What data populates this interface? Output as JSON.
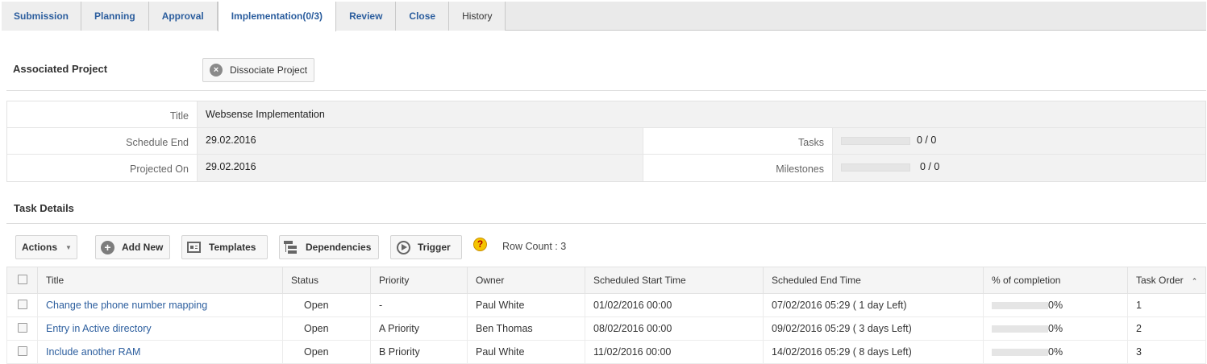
{
  "tabs": [
    "Submission",
    "Planning",
    "Approval",
    "Implementation(0/3)",
    "Review",
    "Close",
    "History"
  ],
  "associated_project": {
    "heading": "Associated Project",
    "dissociate_label": "Dissociate Project",
    "title_label": "Title",
    "title_value": "Websense Implementation",
    "schedule_end_label": "Schedule End",
    "schedule_end_value": "29.02.2016",
    "projected_on_label": "Projected On",
    "projected_on_value": "29.02.2016",
    "tasks_label": "Tasks",
    "tasks_value": "0 / 0",
    "tasks_progress": 0,
    "milestones_label": "Milestones",
    "milestones_value": "0 / 0",
    "milestones_progress": 0
  },
  "task_details": {
    "heading": "Task Details",
    "toolbar": {
      "actions": "Actions",
      "add_new": "Add New",
      "templates": "Templates",
      "dependencies": "Dependencies",
      "trigger": "Trigger",
      "help": "?",
      "row_count": "Row Count : 3"
    },
    "columns": [
      "Title",
      "Status",
      "Priority",
      "Owner",
      "Scheduled Start Time",
      "Scheduled End Time",
      "% of completion",
      "Task Order"
    ],
    "rows": [
      {
        "title": "Change the phone number mapping",
        "status": "Open",
        "priority": "-",
        "owner": "Paul White",
        "start": "01/02/2016 00:00",
        "end": "07/02/2016 05:29 ( 1 day Left)",
        "completion": "0%",
        "order": "1"
      },
      {
        "title": "Entry in Active directory",
        "status": "Open",
        "priority": "A Priority",
        "owner": "Ben Thomas",
        "start": "08/02/2016 00:00",
        "end": "09/02/2016 05:29 ( 3 days Left)",
        "completion": "0%",
        "order": "2"
      },
      {
        "title": "Include another RAM",
        "status": "Open",
        "priority": "B Priority",
        "owner": "Paul White",
        "start": "11/02/2016 00:00",
        "end": "14/02/2016 05:29 ( 8 days Left)",
        "completion": "0%",
        "order": "3"
      }
    ]
  }
}
